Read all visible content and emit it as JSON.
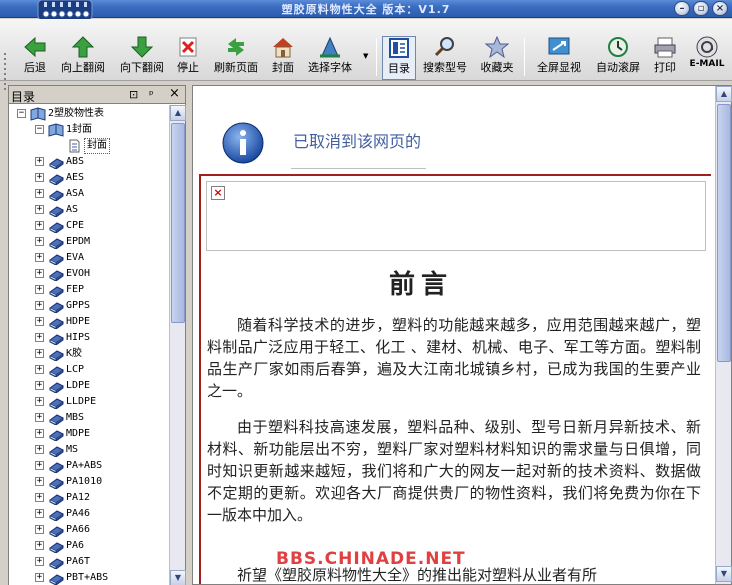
{
  "window": {
    "title": "塑胶原料物性大全  版本：V1.7",
    "controls": [
      "minimize",
      "restore",
      "close"
    ]
  },
  "toolbar": {
    "buttons": [
      {
        "label": "后退",
        "icon": "back-arrow-icon"
      },
      {
        "label": "向上翻阅",
        "icon": "up-arrow-icon"
      },
      {
        "label": "向下翻阅",
        "icon": "down-arrow-icon"
      },
      {
        "label": "停止",
        "icon": "stop-icon"
      },
      {
        "label": "刷新页面",
        "icon": "refresh-icon"
      },
      {
        "label": "封面",
        "icon": "home-icon"
      },
      {
        "label": "选择字体",
        "icon": "font-icon"
      },
      {
        "label": "目录",
        "icon": "contents-icon"
      },
      {
        "label": "搜索型号",
        "icon": "search-icon"
      },
      {
        "label": "收藏夹",
        "icon": "favorites-star-icon"
      },
      {
        "label": "全屏显视",
        "icon": "fullscreen-icon"
      },
      {
        "label": "自动滚屏",
        "icon": "auto-scroll-icon"
      },
      {
        "label": "打印",
        "icon": "print-icon"
      },
      {
        "label": "E-MAIL",
        "icon": "email-icon"
      }
    ]
  },
  "sidebar": {
    "title": "目录",
    "header_buttons": [
      "⊡",
      "ᵖ",
      "×"
    ],
    "tree": {
      "root": "2塑胶物性表",
      "child": "1封面",
      "page": "封面",
      "items": [
        "ABS",
        "AES",
        "ASA",
        "AS",
        "CPE",
        "EPDM",
        "EVA",
        "EVOH",
        "FEP",
        "GPPS",
        "HDPE",
        "HIPS",
        "K胶",
        "LCP",
        "LDPE",
        "LLDPE",
        "MBS",
        "MDPE",
        "MS",
        "PA+ABS",
        "PA1010",
        "PA12",
        "PA46",
        "PA66",
        "PA6",
        "PA6T",
        "PBT+ABS"
      ]
    }
  },
  "content": {
    "cancel_message": "已取消到该网页的",
    "preface_title": "前言",
    "paragraphs": [
      "随着科学技术的进步，塑料的功能越来越多，应用范围越来越广，塑料制品广泛应用于轻工、化工 、建材、机械、电子、军工等方面。塑料制品生产厂家如雨后春笋，遍及大江南北城镇乡村，已成为我国的生要产业之一。",
      "由于塑料科技高速发展，塑料品种、级别、型号日新月异新技术、新材料、新功能层出不穷，塑料厂家对塑料材料知识的需求量与日俱增，同时知识更新越来越短，我们将和广大的网友一起对新的技术资料、数据做不定期的更新。欢迎各大厂商提供贵厂的物性资料，我们将免费为你在下一版本中加入。",
      "祈望《塑胶原料物性大全》的推出能对塑料从业者有所"
    ],
    "watermark": "BBS.CHINADE.NET"
  }
}
